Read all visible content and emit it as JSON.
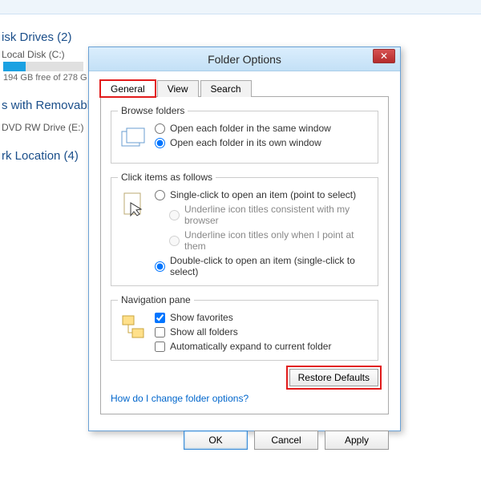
{
  "background": {
    "sections": [
      {
        "title": "isk Drives (2)",
        "drive_label": "Local Disk (C:)",
        "drive_info": "194 GB free of 278 G"
      },
      {
        "title": "s with Removable",
        "sub": "DVD RW Drive (E:)"
      },
      {
        "title": "rk Location (4)"
      }
    ]
  },
  "dialog": {
    "title": "Folder Options",
    "close": "✕",
    "tabs": {
      "general": "General",
      "view": "View",
      "search": "Search"
    },
    "groups": {
      "browse": {
        "title": "Browse folders",
        "opt1": "Open each folder in the same window",
        "opt2": "Open each folder in its own window",
        "selected": "opt2"
      },
      "click": {
        "title": "Click items as follows",
        "opt1": "Single-click to open an item (point to select)",
        "sub1": "Underline icon titles consistent with my browser",
        "sub2": "Underline icon titles only when I point at them",
        "opt2": "Double-click to open an item (single-click to select)",
        "selected": "opt2"
      },
      "nav": {
        "title": "Navigation pane",
        "chk1": "Show favorites",
        "chk2": "Show all folders",
        "chk3": "Automatically expand to current folder"
      }
    },
    "restore": "Restore Defaults",
    "link": "How do I change folder options?",
    "buttons": {
      "ok": "OK",
      "cancel": "Cancel",
      "apply": "Apply"
    }
  }
}
